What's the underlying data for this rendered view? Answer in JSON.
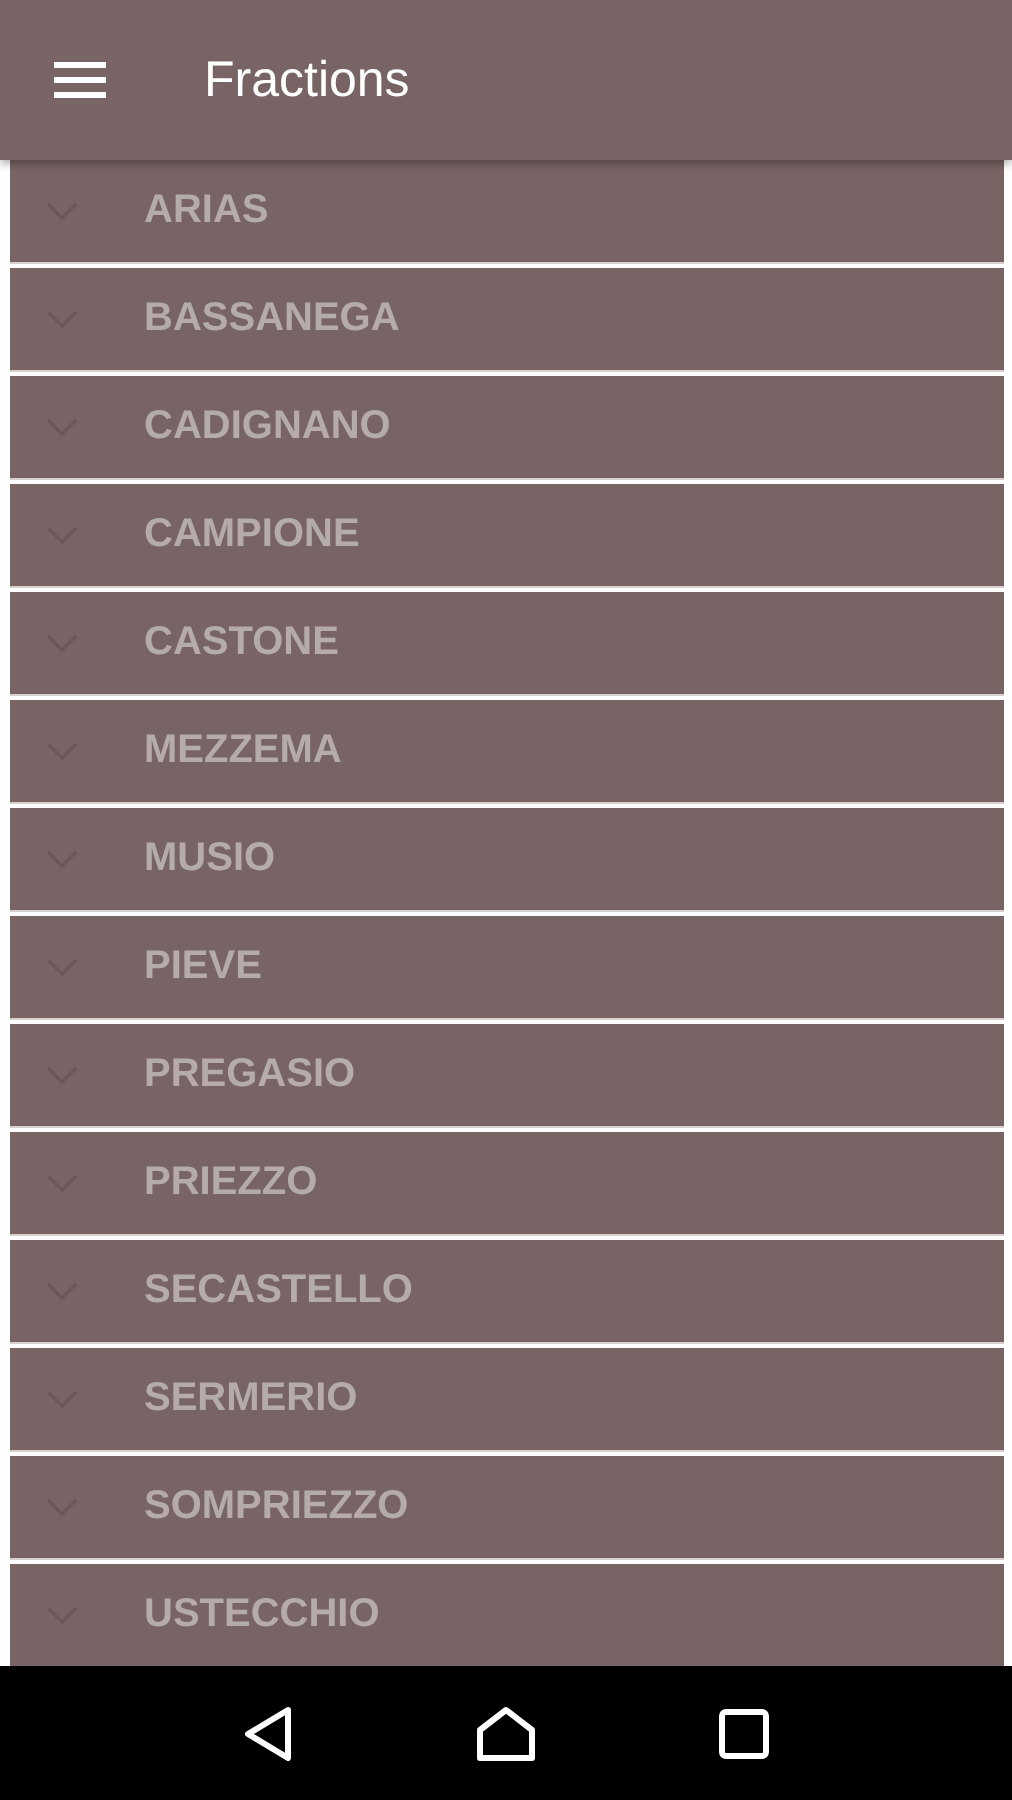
{
  "app_bar": {
    "title": "Fractions"
  },
  "items": [
    {
      "label": "ARIAS",
      "expanded": false
    },
    {
      "label": "BASSANEGA",
      "expanded": false
    },
    {
      "label": "CADIGNANO",
      "expanded": false
    },
    {
      "label": "CAMPIONE",
      "expanded": false
    },
    {
      "label": "CASTONE",
      "expanded": false
    },
    {
      "label": "MEZZEMA",
      "expanded": false
    },
    {
      "label": "MUSIO",
      "expanded": false
    },
    {
      "label": "PIEVE",
      "expanded": false
    },
    {
      "label": "PREGASIO",
      "expanded": false
    },
    {
      "label": "PRIEZZO",
      "expanded": false
    },
    {
      "label": "SECASTELLO",
      "expanded": false
    },
    {
      "label": "SERMERIO",
      "expanded": false
    },
    {
      "label": "SOMPRIEZZO",
      "expanded": false
    },
    {
      "label": "USTECCHIO",
      "expanded": false
    }
  ]
}
